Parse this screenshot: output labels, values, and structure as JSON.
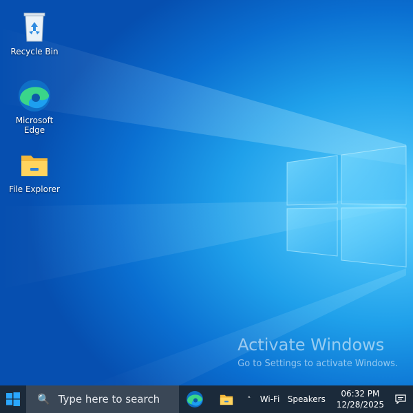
{
  "desktop": {
    "icons": [
      {
        "label": "Recycle Bin",
        "icon": "recycle-bin-icon"
      },
      {
        "label": "Microsoft Edge",
        "icon": "edge-icon"
      },
      {
        "label": "File Explorer",
        "icon": "folder-icon"
      }
    ],
    "watermark": {
      "title": "Activate Windows",
      "subtitle": "Go to Settings to activate Windows."
    }
  },
  "taskbar": {
    "search_placeholder": "Type here to search",
    "pinned": [
      "edge-icon",
      "folder-icon"
    ],
    "tray": {
      "chevron": "˄",
      "wifi_label": "Wi-Fi",
      "speakers_label": "Speakers",
      "time": "06:32 PM",
      "date": "12/28/2025"
    }
  },
  "colors": {
    "taskbar_bg": "#1b2a3a",
    "search_bg": "#3a4756",
    "accent": "#0a78d7"
  }
}
